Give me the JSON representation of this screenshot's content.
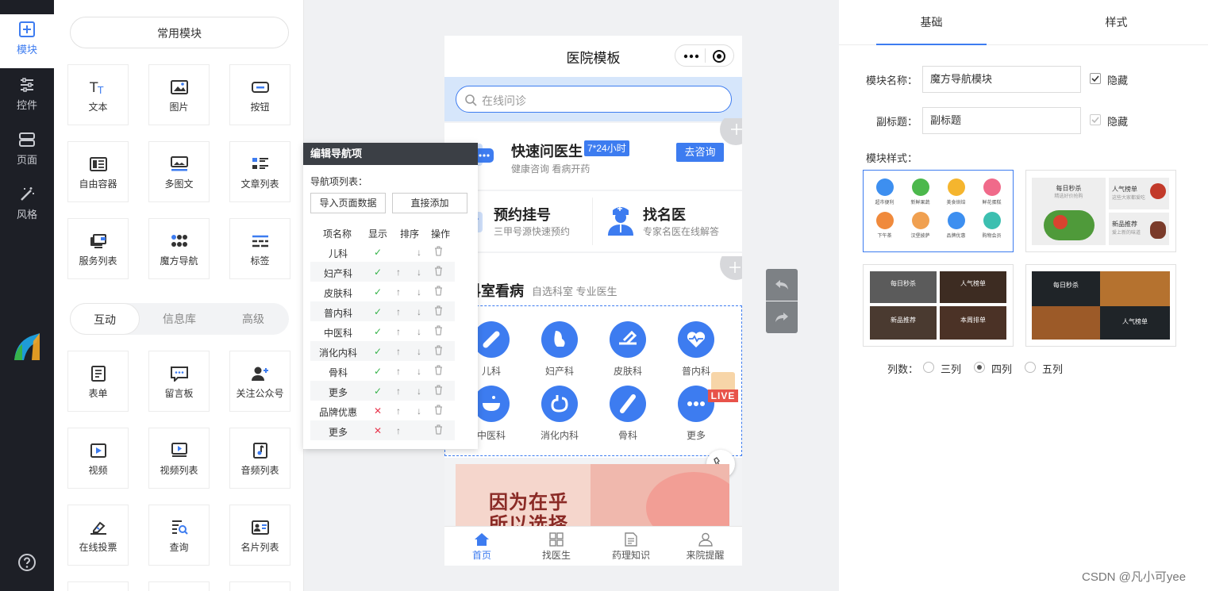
{
  "rail": {
    "items": [
      {
        "label": "模块",
        "icon": "plus-square-icon"
      },
      {
        "label": "控件",
        "icon": "sliders-icon"
      },
      {
        "label": "页面",
        "icon": "page-stack-icon"
      },
      {
        "label": "风格",
        "icon": "magic-wand-icon"
      }
    ],
    "help_icon": "help-icon"
  },
  "modules": {
    "common_title": "常用模块",
    "common": [
      {
        "label": "文本",
        "icon": "text-icon"
      },
      {
        "label": "图片",
        "icon": "image-icon"
      },
      {
        "label": "按钮",
        "icon": "button-icon"
      },
      {
        "label": "自由容器",
        "icon": "container-icon"
      },
      {
        "label": "多图文",
        "icon": "multi-image-text-icon"
      },
      {
        "label": "文章列表",
        "icon": "article-list-icon"
      },
      {
        "label": "服务列表",
        "icon": "service-list-icon"
      },
      {
        "label": "魔方导航",
        "icon": "grid-dots-icon"
      },
      {
        "label": "标签",
        "icon": "tag-icon"
      }
    ],
    "tabs": [
      "互动",
      "信息库",
      "高级"
    ],
    "interactive": [
      {
        "label": "表单",
        "icon": "form-icon"
      },
      {
        "label": "留言板",
        "icon": "message-board-icon"
      },
      {
        "label": "关注公众号",
        "icon": "follow-user-icon"
      },
      {
        "label": "视频",
        "icon": "video-icon"
      },
      {
        "label": "视频列表",
        "icon": "video-list-icon"
      },
      {
        "label": "音频列表",
        "icon": "audio-list-icon"
      },
      {
        "label": "在线投票",
        "icon": "vote-icon"
      },
      {
        "label": "查询",
        "icon": "query-icon"
      },
      {
        "label": "名片列表",
        "icon": "card-list-icon"
      }
    ]
  },
  "phone": {
    "title": "医院模板",
    "search_placeholder": "在线问诊",
    "quick": {
      "title": "快速问医生",
      "badge": "7*24小时",
      "sub": "健康咨询 看病开药",
      "button": "去咨询"
    },
    "appoint": {
      "title": "预约挂号",
      "sub": "三甲号源快速预约"
    },
    "doctor": {
      "title": "找名医",
      "sub": "专家名医在线解答"
    },
    "dept": {
      "title": "科室看病",
      "sub": "自选科室 专业医生"
    },
    "dept_items": [
      "儿科",
      "妇产科",
      "皮肤科",
      "普内科",
      "中医科",
      "消化内科",
      "骨科",
      "更多"
    ],
    "live_badge": "LIVE",
    "banner_line1": "因为在乎",
    "banner_line2": "所以选择",
    "tabbar": [
      {
        "label": "首页",
        "icon": "home-icon"
      },
      {
        "label": "找医生",
        "icon": "grid-icon"
      },
      {
        "label": "药理知识",
        "icon": "document-icon"
      },
      {
        "label": "来院提醒",
        "icon": "user-icon"
      }
    ]
  },
  "popup": {
    "title": "编辑导航项",
    "list_label": "导航项列表：",
    "import_button": "导入页面数据",
    "add_button": "直接添加",
    "headers": [
      "项名称",
      "显示",
      "排序",
      "操作"
    ],
    "rows": [
      {
        "name": "儿科",
        "show": "✓",
        "up": false,
        "down": true
      },
      {
        "name": "妇产科",
        "show": "✓",
        "up": true,
        "down": true
      },
      {
        "name": "皮肤科",
        "show": "✓",
        "up": true,
        "down": true
      },
      {
        "name": "普内科",
        "show": "✓",
        "up": true,
        "down": true
      },
      {
        "name": "中医科",
        "show": "✓",
        "up": true,
        "down": true
      },
      {
        "name": "消化内科",
        "show": "✓",
        "up": true,
        "down": true
      },
      {
        "name": "骨科",
        "show": "✓",
        "up": true,
        "down": true
      },
      {
        "name": "更多",
        "show": "✓",
        "up": true,
        "down": true
      },
      {
        "name": "品牌优惠",
        "show": "✕",
        "up": true,
        "down": true
      },
      {
        "name": "更多",
        "show": "✕",
        "up": true,
        "down": false
      }
    ]
  },
  "settings": {
    "tabs": [
      "基础",
      "样式"
    ],
    "name_label": "模块名称：",
    "name_value": "魔方导航模块",
    "hide_label": "隐藏",
    "subtitle_label": "副标题：",
    "subtitle_value": "副标题",
    "style_label": "模块样式：",
    "style1_items": [
      "超市便利",
      "新鲜果蔬",
      "美食烘焙",
      "鲜花蛋糕",
      "下午茶",
      "汉堡披萨",
      "品牌优惠",
      "购物会员"
    ],
    "style2_items": [
      "每日秒杀",
      "人气榜单",
      "新品推荐"
    ],
    "style2_subs": [
      "精选好价抢购",
      "这些大家都爱吃",
      "爱上新的味道"
    ],
    "style3_items": [
      "每日秒杀",
      "人气榜单",
      "新品推荐",
      "本周排单"
    ],
    "style4_items": [
      "每日秒杀",
      "人气榜单"
    ],
    "columns_label": "列数：",
    "columns": [
      "三列",
      "四列",
      "五列"
    ],
    "columns_selected": "四列"
  },
  "watermark": "CSDN @凡小可yee",
  "colors": {
    "accent": "#3d7cf0",
    "rail_bg": "#1d1f26",
    "live": "#e8534a",
    "check": "#36b34a",
    "cross": "#e8384f"
  }
}
